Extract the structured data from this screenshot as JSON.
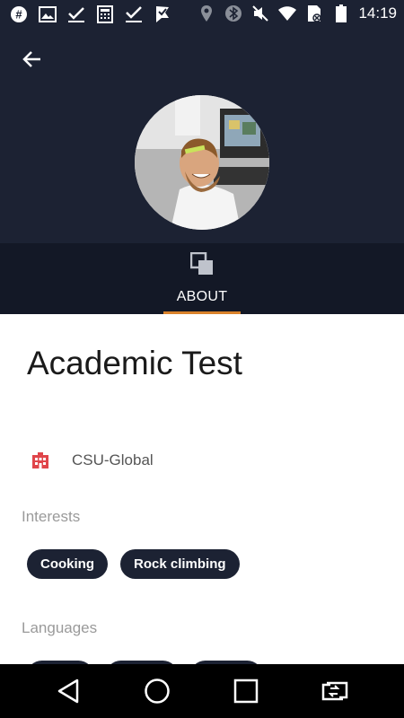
{
  "status_bar": {
    "time": "14:19",
    "left_icons": [
      "hashtag-icon",
      "image-icon",
      "check-icon",
      "calculator-icon",
      "checkmark-icon",
      "flag-check-icon"
    ],
    "right_icons": [
      "location-icon",
      "bluetooth-icon",
      "mute-icon",
      "wifi-icon",
      "sim-icon",
      "battery-icon"
    ]
  },
  "header": {
    "back_icon": "back-arrow-icon",
    "background_color": "#1c2233"
  },
  "tabs": [
    {
      "label": "ABOUT",
      "icon": "layers-icon",
      "active": true
    }
  ],
  "profile": {
    "name": "Academic Test",
    "organization": "CSU-Global",
    "organization_icon": "building-icon"
  },
  "interests": {
    "label": "Interests",
    "items": [
      "Cooking",
      "Rock climbing"
    ]
  },
  "languages": {
    "label": "Languages"
  },
  "nav_bar": {
    "buttons": [
      "back-triangle-icon",
      "home-circle-icon",
      "recents-square-icon",
      "screen-switch-icon"
    ]
  },
  "colors": {
    "header_bg": "#1c2233",
    "tab_bg": "#131826",
    "accent": "#d9822b",
    "chip_bg": "#1c2233",
    "org_icon": "#e0454a"
  }
}
